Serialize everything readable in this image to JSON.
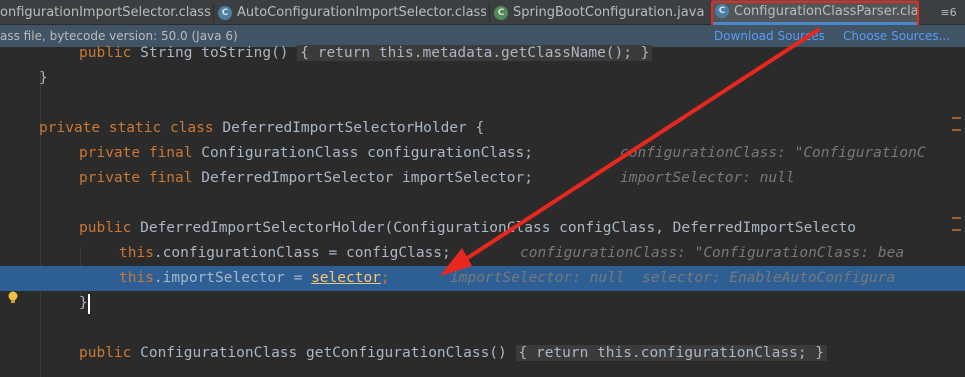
{
  "tabs": [
    {
      "label": "onfigurationImportSelector.class",
      "active": false,
      "icon": "class-icon"
    },
    {
      "label": "AutoConfigurationImportSelector.class",
      "active": false,
      "icon": "class-icon"
    },
    {
      "label": "SpringBootConfiguration.java",
      "active": false,
      "icon": "class-icon"
    },
    {
      "label": "ConfigurationClassParser.class",
      "active": true,
      "icon": "class-icon"
    }
  ],
  "tab_close_glyph": "×",
  "tab_menu_label": "≡6",
  "banner": {
    "message": "ass file, bytecode version: 50.0 (Java 6)",
    "download_sources": "Download Sources",
    "choose_sources": "Choose Sources..."
  },
  "code": {
    "l1_kw": "public",
    "l1_a": " String toString() ",
    "l1_fold": "{ return this.metadata.getClassName(); }",
    "l2": "}",
    "l3_kw": "private static class",
    "l3_a": " DeferredImportSelectorHolder {",
    "l4_kw": "private final",
    "l4_a": " ConfigurationClass configurationClass;",
    "l4_hint": "configurationClass: \"ConfigurationC",
    "l5_kw": "private final",
    "l5_a": " DeferredImportSelector importSelector;",
    "l5_hint": "importSelector: null",
    "l6_kw": "public",
    "l6_a": " DeferredImportSelectorHolder(ConfigurationClass configClass, DeferredImportSelecto",
    "l7_kw": "this",
    "l7_a": ".configurationClass = configClass;",
    "l7_hint": "configurationClass: \"ConfigurationClass: bea",
    "l8_kw": "this",
    "l8_a": ".importSelector = ",
    "l8_sel": "selector",
    "l8_b": ";",
    "l8_hint": "importSelector: null  selector: EnableAutoConfigura",
    "l9": "}",
    "l10_kw": "public",
    "l10_a": " ConfigurationClass getConfigurationClass() ",
    "l10_fold": "{ return this.configurationClass; }"
  },
  "colors": {
    "annotation_red": "#e8271f",
    "highlight_line": "#2d5f94",
    "keyword": "#cc7832",
    "link": "#589df6"
  }
}
